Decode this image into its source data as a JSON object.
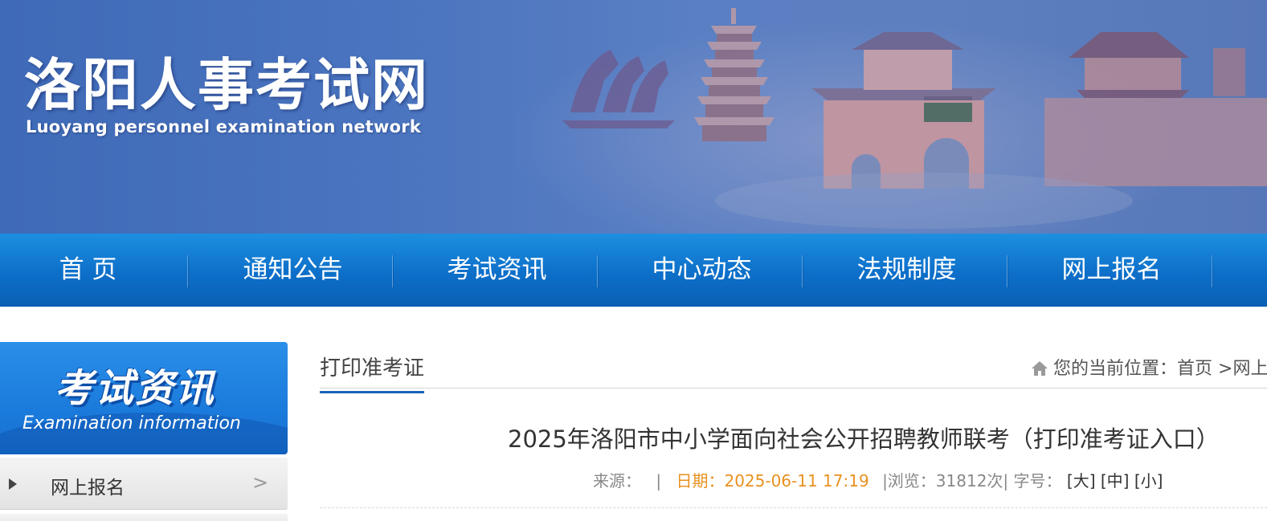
{
  "header": {
    "title": "洛阳人事考试网",
    "subtitle": "Luoyang personnel examination network"
  },
  "nav": {
    "items": [
      "首 页",
      "通知公告",
      "考试资讯",
      "中心动态",
      "法规制度",
      "网上报名"
    ]
  },
  "sidebar": {
    "title": "考试资讯",
    "subtitle": "Examination information",
    "items": [
      {
        "label": "网上报名"
      }
    ]
  },
  "content": {
    "tab": "打印准考证",
    "breadcrumb": {
      "prefix": "您的当前位置：",
      "home": "首页",
      "rest": " >网上"
    },
    "article": {
      "title": "2025年洛阳市中小学面向社会公开招聘教师联考（打印准考证入口）",
      "source_label": "来源：",
      "separator": "|",
      "date": "日期：2025-06-11 17:19",
      "views": "|浏览：31812次|",
      "font_label": "字号：",
      "size_large": "[大]",
      "size_medium": "[中]",
      "size_small": "[小]"
    }
  },
  "colors": {
    "nav_blue": "#0d6fc9",
    "date_orange": "#e8911f",
    "tab_underline": "#1a63b8"
  }
}
